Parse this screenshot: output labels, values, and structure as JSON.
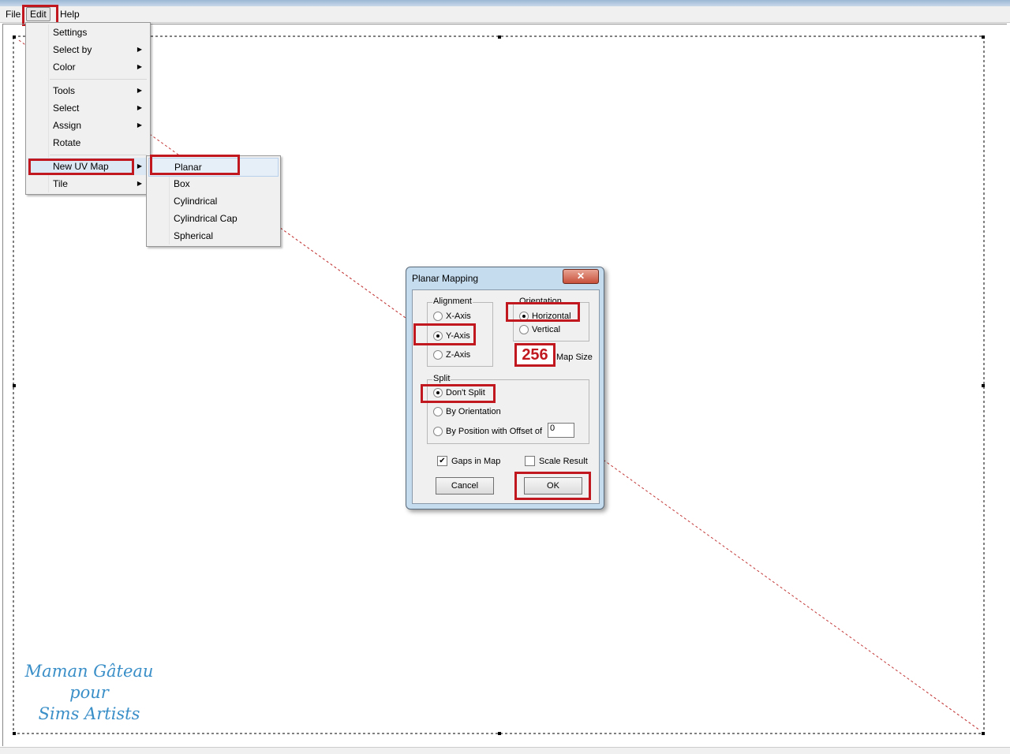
{
  "menubar": {
    "items": [
      "File",
      "Edit",
      "Help"
    ]
  },
  "edit_menu": {
    "items": [
      {
        "label": "Settings",
        "sub": false
      },
      {
        "label": "Select by",
        "sub": true
      },
      {
        "label": "Color",
        "sub": true
      },
      {
        "label": "Tools",
        "sub": true
      },
      {
        "label": "Select",
        "sub": true
      },
      {
        "label": "Assign",
        "sub": true
      },
      {
        "label": "Rotate",
        "sub": false
      },
      {
        "label": "New UV Map",
        "sub": true
      },
      {
        "label": "Tile",
        "sub": true
      }
    ]
  },
  "submenu": {
    "items": [
      "Planar",
      "Box",
      "Cylindrical",
      "Cylindrical Cap",
      "Spherical"
    ]
  },
  "dialog": {
    "title": "Planar Mapping",
    "close": "✕",
    "alignment": {
      "label": "Alignment",
      "options": [
        "X-Axis",
        "Y-Axis",
        "Z-Axis"
      ],
      "selected": "Y-Axis"
    },
    "orientation": {
      "label": "Orientation",
      "options": [
        "Horizontal",
        "Vertical"
      ],
      "selected": "Horizontal"
    },
    "map_size": {
      "value": "256",
      "label": "Map Size"
    },
    "split": {
      "label": "Split",
      "options": [
        "Don't Split",
        "By Orientation",
        "By Position with Offset of"
      ],
      "selected": "Don't Split",
      "offset": "0"
    },
    "gaps_in_map": {
      "label": "Gaps in Map",
      "checked": true
    },
    "scale_result": {
      "label": "Scale Result",
      "checked": false
    },
    "cancel": "Cancel",
    "ok": "OK"
  },
  "watermark": {
    "line1": "Maman Gâteau",
    "line2": "pour",
    "line3": "Sims Artists"
  },
  "colors": {
    "highlight": "#c0181e",
    "watermark": "#3a8fc8",
    "diagonal": "#c03030"
  }
}
